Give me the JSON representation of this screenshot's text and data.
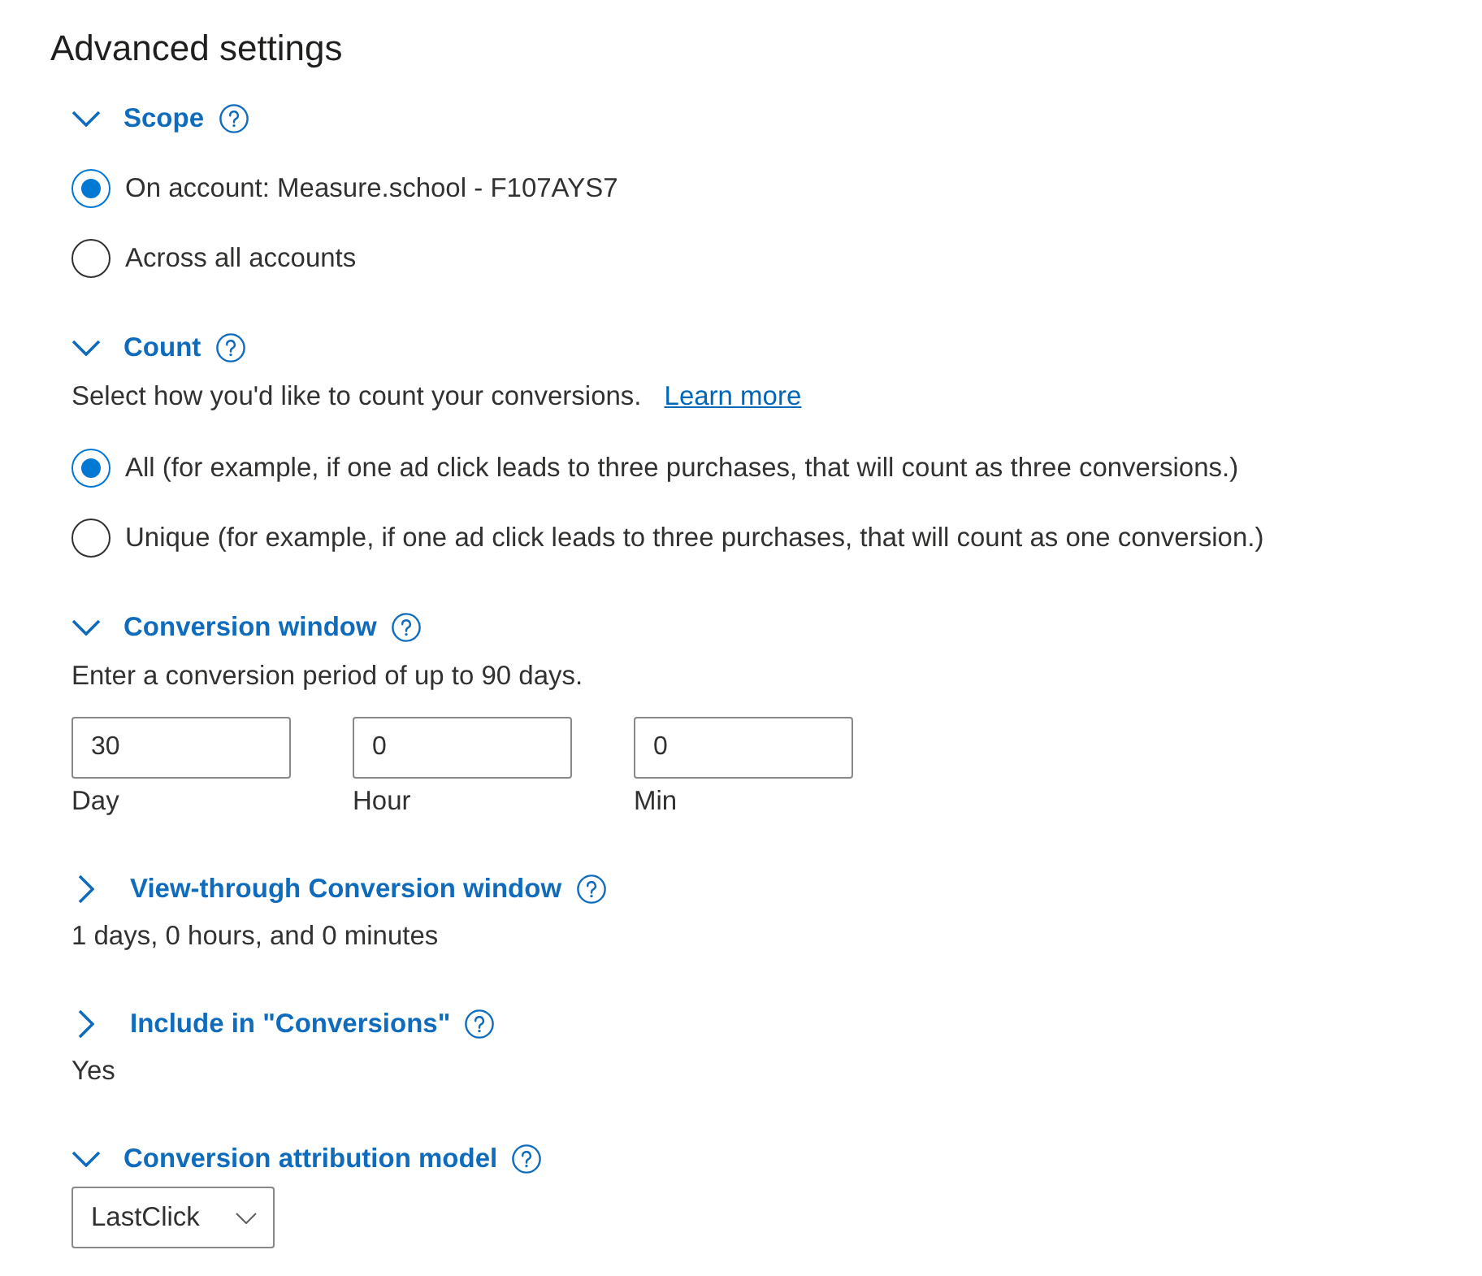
{
  "title": "Advanced settings",
  "sections": [
    {
      "kind": "radios",
      "label": "Scope",
      "expanded": true,
      "options": [
        {
          "label": "On account: Measure.school - F107AYS7",
          "selected": true
        },
        {
          "label": "Across all accounts",
          "selected": false
        }
      ]
    },
    {
      "kind": "radios",
      "label": "Count",
      "expanded": true,
      "description": "Select how you'd like to count your conversions.",
      "link": "Learn more",
      "options": [
        {
          "label": "All (for example, if one ad click leads to three purchases, that will count as three conversions.)",
          "selected": true
        },
        {
          "label": "Unique (for example, if one ad click leads to three purchases, that will count as one conversion.)",
          "selected": false
        }
      ]
    },
    {
      "kind": "fields",
      "label": "Conversion window",
      "expanded": true,
      "description": "Enter a conversion period of up to 90 days.",
      "fields": [
        {
          "value": "30",
          "caption": "Day"
        },
        {
          "value": "0",
          "caption": "Hour"
        },
        {
          "value": "0",
          "caption": "Min"
        }
      ]
    },
    {
      "kind": "summary",
      "label": "View-through Conversion window",
      "expanded": false,
      "value": "1 days, 0 hours, and 0 minutes"
    },
    {
      "kind": "summary",
      "label": "Include in \"Conversions\"",
      "expanded": false,
      "value": "Yes"
    },
    {
      "kind": "dropdown",
      "label": "Conversion attribution model",
      "expanded": true,
      "value": "LastClick"
    }
  ]
}
